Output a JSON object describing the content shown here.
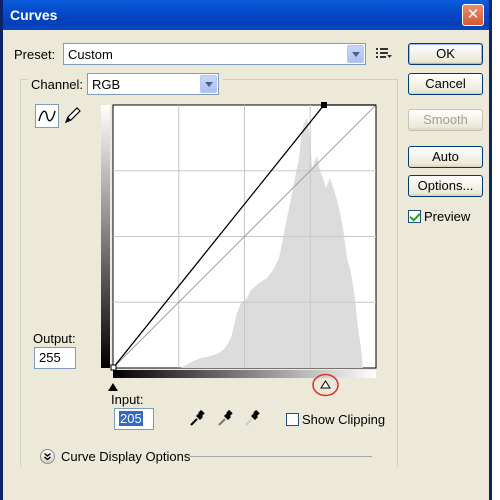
{
  "window": {
    "title": "Curves",
    "close_label": "✕"
  },
  "preset": {
    "label": "Preset:",
    "value": "Custom"
  },
  "channel": {
    "label": "Channel:",
    "value": "RGB"
  },
  "buttons": {
    "ok": "OK",
    "cancel": "Cancel",
    "smooth": "Smooth",
    "auto": "Auto",
    "options": "Options..."
  },
  "preview": {
    "label": "Preview",
    "checked": true
  },
  "output": {
    "label": "Output:",
    "value": "255"
  },
  "input": {
    "label": "Input:",
    "value": "205"
  },
  "show_clipping": {
    "label": "Show Clipping",
    "checked": false
  },
  "curve_display_options": {
    "label": "Curve Display Options"
  },
  "colors": {
    "titlebar": "#0548c8",
    "dialog_bg": "#ece9d8",
    "highlight_circle": "#e0302a",
    "histogram": "#dcdcdc",
    "input_selection": "#316ac5"
  },
  "curve": {
    "points": [
      [
        0,
        0
      ],
      [
        205,
        255
      ]
    ],
    "white_point_input": 205,
    "black_point_input": 0
  }
}
